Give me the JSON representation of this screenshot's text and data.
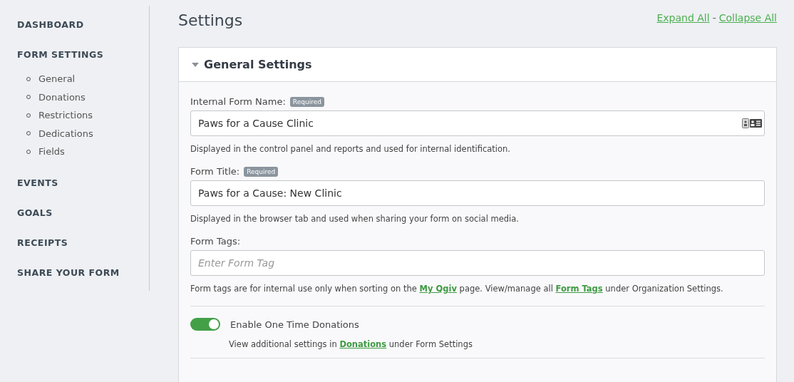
{
  "sidebar": {
    "sections": [
      {
        "label": "DASHBOARD"
      },
      {
        "label": "FORM SETTINGS",
        "items": [
          "General",
          "Donations",
          "Restrictions",
          "Dedications",
          "Fields"
        ]
      },
      {
        "label": "EVENTS"
      },
      {
        "label": "GOALS"
      },
      {
        "label": "RECEIPTS"
      },
      {
        "label": "SHARE YOUR FORM"
      }
    ]
  },
  "page": {
    "title": "Settings",
    "expand_all": "Expand All",
    "separator": "-",
    "collapse_all": "Collapse All"
  },
  "panel": {
    "title": "General Settings",
    "expanded": true,
    "fields": [
      {
        "label": "Internal Form Name:",
        "badge": "Required",
        "value": "Paws for a Cause Clinic",
        "contact_icon": true,
        "help": [
          {
            "kind": "text",
            "text": "Displayed in the control panel and reports and used for internal identification."
          }
        ]
      },
      {
        "label": "Form Title:",
        "badge": "Required",
        "value": "Paws for a Cause: New Clinic",
        "contact_icon": false,
        "help": [
          {
            "kind": "text",
            "text": "Displayed in the browser tab and used when sharing your form on social media."
          }
        ]
      },
      {
        "label": "Form Tags:",
        "placeholder": "Enter Form Tag",
        "contact_icon": false,
        "help": [
          {
            "kind": "text",
            "text": "Form tags are for internal use only when sorting on the "
          },
          {
            "kind": "link",
            "text": "My Qgiv"
          },
          {
            "kind": "text",
            "text": " page. View/manage all "
          },
          {
            "kind": "link",
            "text": "Form Tags"
          },
          {
            "kind": "text",
            "text": " under Organization Settings."
          }
        ]
      }
    ],
    "toggle": {
      "label": "Enable One Time Donations",
      "on": true,
      "help": [
        {
          "kind": "text",
          "text": "View additional settings in "
        },
        {
          "kind": "link",
          "text": "Donations"
        },
        {
          "kind": "text",
          "text": " under Form Settings"
        }
      ]
    }
  }
}
